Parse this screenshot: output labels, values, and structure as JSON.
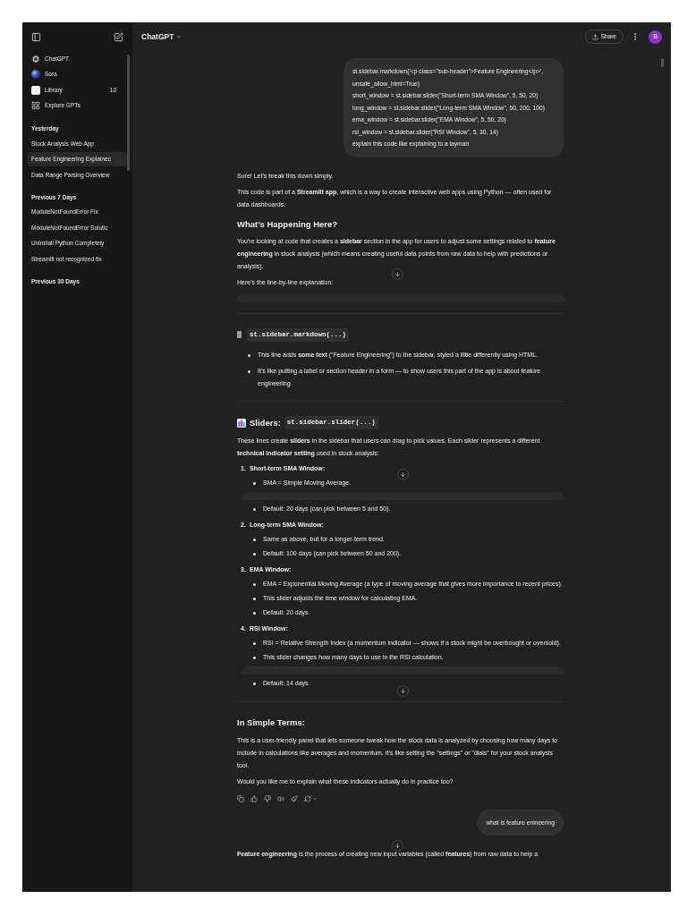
{
  "sidebar": {
    "nav": [
      {
        "label": "ChatGPT"
      },
      {
        "label": "Sora"
      },
      {
        "label": "Library",
        "count": "10"
      },
      {
        "label": "Explore GPTs"
      }
    ],
    "groups": [
      {
        "heading": "Yesterday",
        "chats": [
          {
            "title": "Stock Analysis Web App",
            "selected": false
          },
          {
            "title": "Feature Engineering Explainec",
            "selected": true
          },
          {
            "title": "Data Range Parsing Overview",
            "selected": false
          }
        ]
      },
      {
        "heading": "Previous 7 Days",
        "chats": [
          {
            "title": "ModuleNotFoundError Fix",
            "selected": false
          },
          {
            "title": "ModuleNotFoundError Solutic",
            "selected": false
          },
          {
            "title": "Uninstall Python Completely",
            "selected": false
          },
          {
            "title": "Streamlit not recognized fix",
            "selected": false
          }
        ]
      },
      {
        "heading": "Previous 30 Days"
      }
    ]
  },
  "header": {
    "title": "ChatGPT",
    "share": "Share",
    "avatar": "B"
  },
  "messages": [
    {
      "kind": "user",
      "text": "st.sidebar.markdown('<p class=\"sub-header\">Feature Engineering</p>', unsafe_allow_html=True)\nshort_window = st.sidebar.slider(\"Short-term SMA Window\", 5, 50, 20)\nlong_window = st.sidebar.slider(\"Long-term SMA Window\", 50, 200, 100)\nema_window = st.sidebar.slider(\"EMA Window\", 5, 50, 20)\nrsi_window = st.sidebar.slider(\"RSI Window\", 5, 30, 14)\nexplain this code like explaining to a layman"
    },
    {
      "kind": "assistant",
      "blocks": [
        {
          "kind": "p",
          "text": "Sure! Let’s break this down simply."
        },
        {
          "kind": "p",
          "text": "This code is part of a **Streamlit app**, which is a way to create interactive web apps using Python — often used for data dashboards."
        },
        {
          "kind": "h3",
          "text": "What’s Happening Here?"
        },
        {
          "kind": "p",
          "text": "You’re looking at code that creates a **sidebar** section in the app for users to adjust some settings related to **feature engineering** in stock analysis (which means creating useful data points from raw data to help with predictions or analysis)."
        },
        {
          "kind": "jump"
        },
        {
          "kind": "p",
          "text": "Here’s the line-by-line explanation:"
        },
        {
          "kind": "band"
        },
        {
          "kind": "hr"
        },
        {
          "kind": "code_heading",
          "code": "st.sidebar.markdown(...)"
        },
        {
          "kind": "bullet",
          "text": "This line adds **some text** (\"Feature Engineering\") to the sidebar, styled a little differently using HTML."
        },
        {
          "kind": "bullet",
          "text": "It’s like putting a label or section header in a form — to show users this part of the app is about feature engineering."
        },
        {
          "kind": "hr"
        },
        {
          "kind": "chart_heading",
          "text": "Sliders:",
          "code": "st.sidebar.slider(...)"
        },
        {
          "kind": "p",
          "text": "These lines create **sliders** in the sidebar that users can drag to pick values. Each slider represents a different **technical indicator setting** used in stock analysis:"
        },
        {
          "kind": "ol_item",
          "label": "1.",
          "title": "Short-term SMA Window:",
          "children": [
            {
              "kind": "jump"
            },
            {
              "kind": "bullet",
              "text": "SMA = Simple Moving Average."
            },
            {
              "kind": "band"
            },
            {
              "kind": "bullet",
              "text": "Default: 20 days (can pick between 5 and 50)."
            }
          ]
        },
        {
          "kind": "ol_item",
          "label": "2.",
          "title": "Long-term SMA Window:",
          "children": [
            {
              "kind": "bullet",
              "text": "Same as above, but for a longer-term trend."
            },
            {
              "kind": "bullet",
              "text": "Default: 100 days (can pick between 50 and 200)."
            }
          ]
        },
        {
          "kind": "ol_item",
          "label": "3.",
          "title": "EMA Window:",
          "children": [
            {
              "kind": "bullet",
              "text": "EMA = Exponential Moving Average (a type of moving average that gives more importance to recent prices)."
            },
            {
              "kind": "bullet",
              "text": "This slider adjusts the time window for calculating EMA."
            },
            {
              "kind": "bullet",
              "text": "Default: 20 days."
            }
          ]
        },
        {
          "kind": "ol_item",
          "label": "4.",
          "title": "RSI Window:",
          "children": [
            {
              "kind": "bullet",
              "text": "RSI = Relative Strength Index (a momentum indicator — shows if a stock might be overbought or oversold)."
            },
            {
              "kind": "bullet",
              "text": "This slider changes how many days to use in the RSI calculation."
            },
            {
              "kind": "band"
            },
            {
              "kind": "bullet",
              "text": "Default: 14 days."
            },
            {
              "kind": "jump"
            }
          ]
        },
        {
          "kind": "hr"
        },
        {
          "kind": "h3",
          "text": "In Simple Terms:"
        },
        {
          "kind": "p",
          "text": "This is a user-friendly panel that lets someone tweak how the stock data is analyzed by choosing how many days to include in calculations like averages and momentum. It’s like setting the \"settings\" or \"dials\" for your stock analysis tool."
        },
        {
          "kind": "p",
          "text": "Would you like me to explain what these indicators actually do in practice too?"
        },
        {
          "kind": "actions"
        }
      ]
    },
    {
      "kind": "user",
      "text": "what is feature enineering"
    },
    {
      "kind": "assistant",
      "blocks": [
        {
          "kind": "jump"
        },
        {
          "kind": "p",
          "text": "**Feature engineering** is the process of creating new input variables (called **features**) from raw data to help a"
        }
      ]
    }
  ]
}
